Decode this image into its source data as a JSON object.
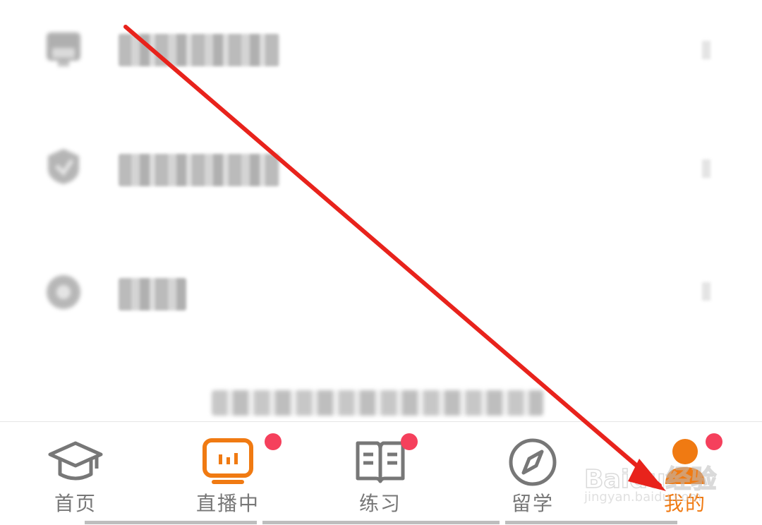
{
  "menu": {
    "items": [
      {
        "icon": "blurred-icon",
        "label": ""
      },
      {
        "icon": "blurred-icon",
        "label": ""
      },
      {
        "icon": "blurred-icon",
        "label": ""
      }
    ]
  },
  "tabbar": {
    "tabs": [
      {
        "label": "首页",
        "icon": "graduation-cap-icon",
        "active": false,
        "badge": false
      },
      {
        "label": "直播中",
        "icon": "live-tv-icon",
        "active": false,
        "badge": true
      },
      {
        "label": "练习",
        "icon": "open-book-icon",
        "active": false,
        "badge": true
      },
      {
        "label": "留学",
        "icon": "compass-icon",
        "active": false,
        "badge": false
      },
      {
        "label": "我的",
        "icon": "profile-icon",
        "active": true,
        "badge": true
      }
    ]
  },
  "watermark": {
    "brand": "Baidu经验",
    "sub": "jingyan.baidu.com"
  },
  "colors": {
    "accent": "#f07a12",
    "badge": "#f5405c",
    "inactive": "#777777",
    "arrow": "#e8231c"
  }
}
